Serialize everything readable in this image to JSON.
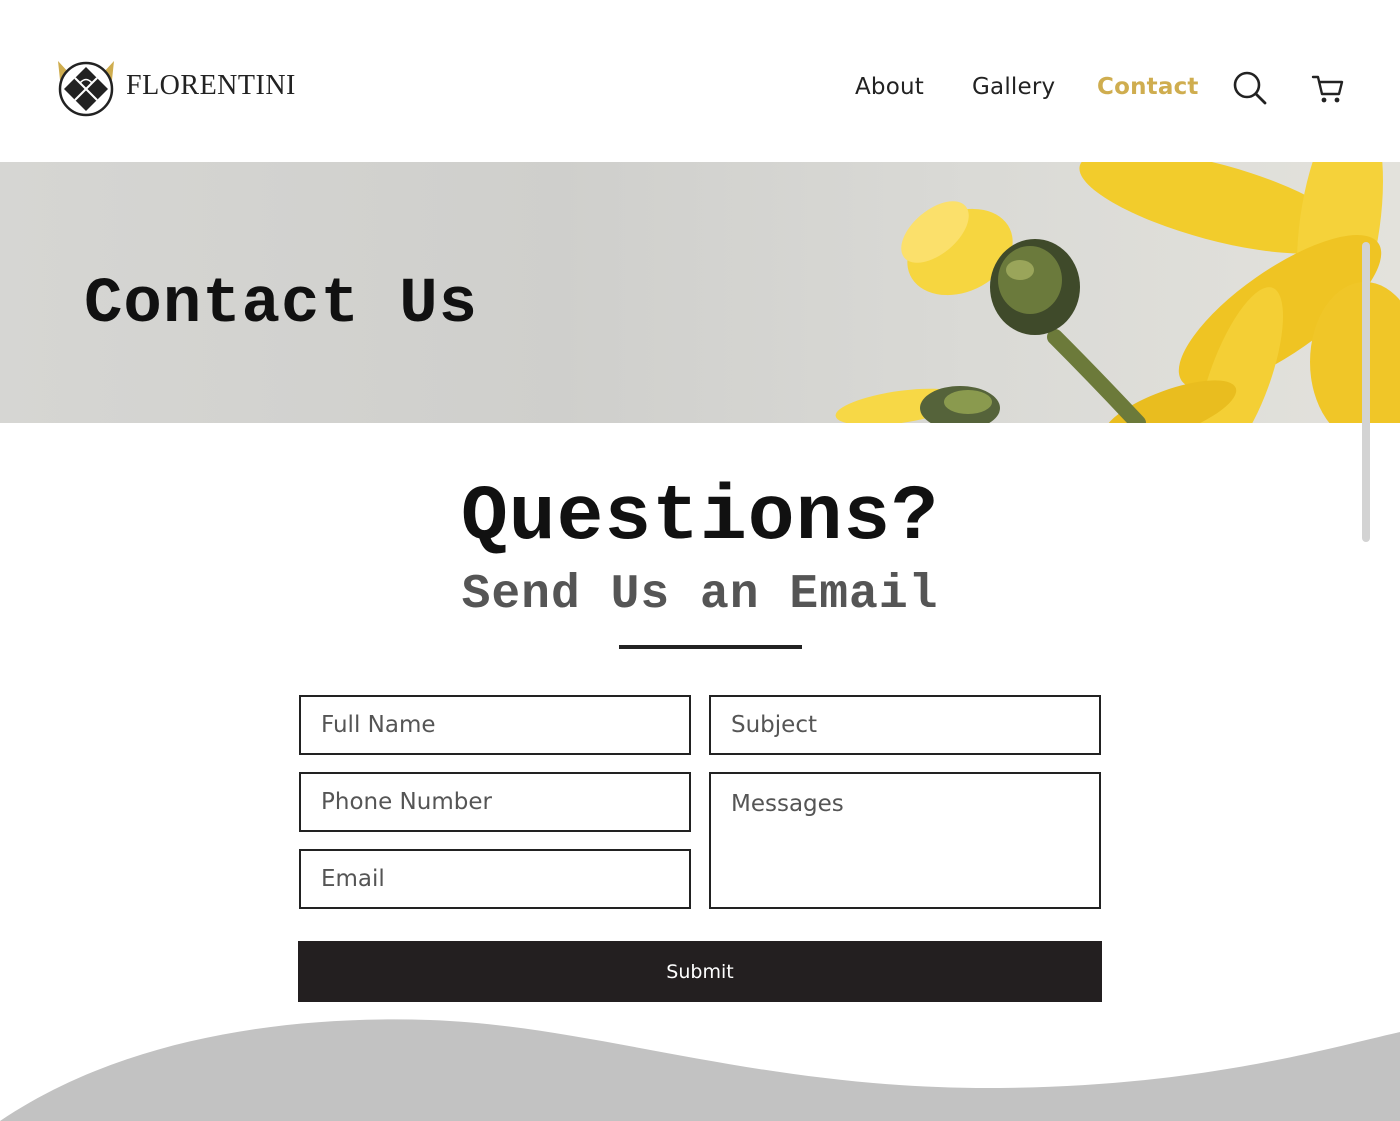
{
  "header": {
    "brand": "FLORENTINI",
    "nav": [
      {
        "label": "About"
      },
      {
        "label": "Gallery"
      },
      {
        "label": "Contact"
      }
    ],
    "active_nav": "Contact",
    "icons": [
      "search-icon",
      "cart-icon"
    ]
  },
  "hero": {
    "title": "Contact Us"
  },
  "section": {
    "title": "Questions?",
    "subtitle": "Send Us an Email"
  },
  "form": {
    "full_name_placeholder": "Full Name",
    "subject_placeholder": "Subject",
    "phone_placeholder": "Phone Number",
    "email_placeholder": "Email",
    "messages_placeholder": "Messages",
    "submit_label": "Submit"
  },
  "colors": {
    "accent": "#cfad4f",
    "button": "#231f20",
    "text": "#222222",
    "subtitle": "#555555",
    "footer_wave": "#c2c2c2"
  }
}
